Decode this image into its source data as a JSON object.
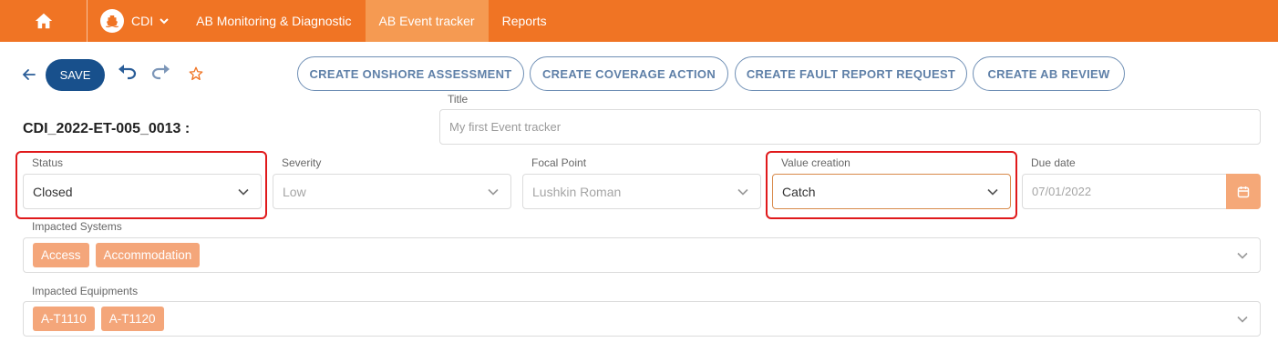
{
  "nav": {
    "app_name": "CDI",
    "items": [
      {
        "label": "AB Monitoring & Diagnostic",
        "active": false
      },
      {
        "label": "AB Event tracker",
        "active": true
      },
      {
        "label": "Reports",
        "active": false
      }
    ]
  },
  "toolbar": {
    "save_label": "SAVE",
    "actions": [
      "CREATE ONSHORE ASSESSMENT",
      "CREATE COVERAGE ACTION",
      "CREATE FAULT REPORT REQUEST",
      "CREATE AB REVIEW"
    ]
  },
  "record": {
    "id": "CDI_2022-ET-005_0013 :",
    "title_label": "Title",
    "title_value": "My first Event tracker"
  },
  "fields": {
    "status": {
      "label": "Status",
      "value": "Closed"
    },
    "severity": {
      "label": "Severity",
      "value": "Low"
    },
    "focal_point": {
      "label": "Focal Point",
      "value": "Lushkin Roman"
    },
    "value_creation": {
      "label": "Value creation",
      "value": "Catch"
    },
    "due_date": {
      "label": "Due date",
      "value": "07/01/2022"
    }
  },
  "impacted_systems": {
    "label": "Impacted Systems",
    "chips": [
      "Access",
      "Accommodation"
    ]
  },
  "impacted_equipments": {
    "label": "Impacted Equipments",
    "chips": [
      "A-T1110",
      "A-T1120"
    ]
  },
  "colors": {
    "nav_bg": "#f07424",
    "nav_active": "#f59a52",
    "save_btn": "#18508c",
    "chip": "#f4a67a",
    "highlight": "#e0191b"
  }
}
